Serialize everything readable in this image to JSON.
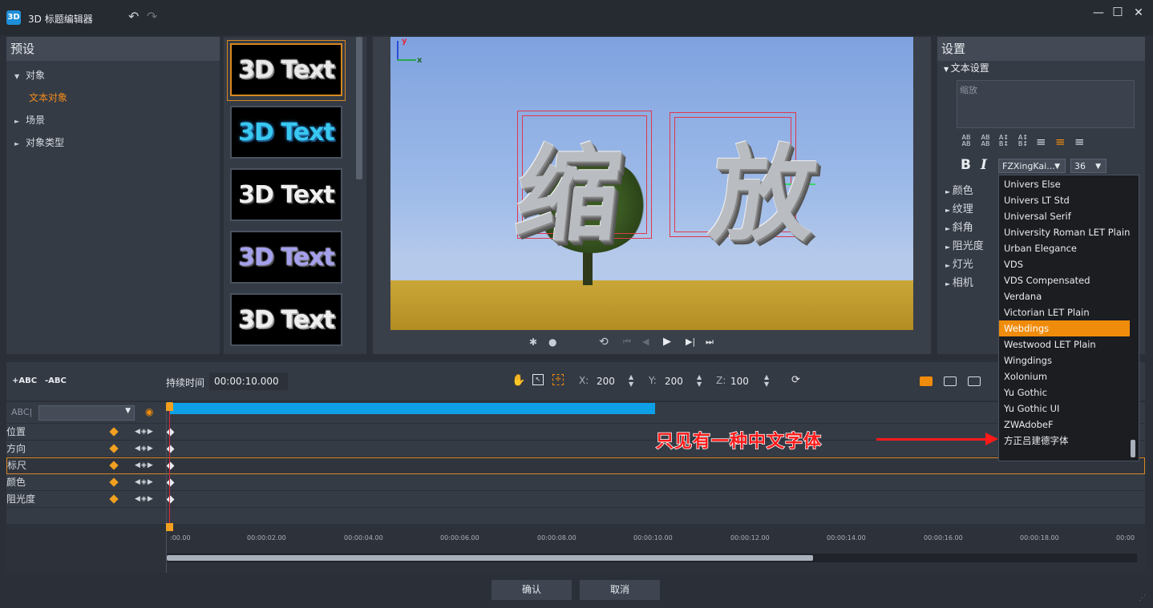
{
  "window": {
    "logo": "3D",
    "title": "3D 标题编辑器",
    "controls": {
      "minimize": "—",
      "maximize": "□",
      "close": "✕"
    }
  },
  "presets": {
    "header": "预设",
    "items": [
      {
        "arrow": "▼",
        "label": "对象"
      },
      {
        "arrow": "",
        "label": "文本对象"
      },
      {
        "arrow": "►",
        "label": "场景"
      },
      {
        "arrow": "►",
        "label": "对象类型"
      }
    ],
    "thumbs": [
      "3D Text",
      "3D Text",
      "3D Text",
      "3D Text",
      "3D Text"
    ]
  },
  "preview": {
    "axis_y": "y",
    "axis_x": "x",
    "text": "缩 放"
  },
  "settings": {
    "header": "设置",
    "section": "文本设置",
    "text_value": "缩放",
    "bold": "B",
    "italic": "I",
    "font_selected": "FZXingKai...",
    "size_selected": "36",
    "groups": [
      "颜色",
      "纹理",
      "斜角",
      "阻光度",
      "灯光",
      "相机"
    ],
    "font_options": [
      "Univers Else",
      "Univers LT Std",
      "Universal Serif",
      "University Roman LET Plain",
      "Urban Elegance",
      "VDS",
      "VDS Compensated",
      "Verdana",
      "Victorian LET Plain",
      "Webdings",
      "Westwood LET Plain",
      "Wingdings",
      "Xolonium",
      "Yu Gothic",
      "Yu Gothic UI",
      "ZWAdobeF",
      "方正吕建德字体"
    ],
    "highlighted_font": "Webdings"
  },
  "timeline": {
    "add_abc": "+ABC",
    "remove_abc": "-ABC",
    "duration_label": "持续时间",
    "duration_value": "00:00:10.000",
    "x_label": "X:",
    "x_value": "200",
    "y_label": "Y:",
    "y_value": "200",
    "z_label": "Z:",
    "z_value": "100",
    "track_selector": "ABC|",
    "tracks": [
      "位置",
      "方向",
      "标尺",
      "颜色",
      "阻光度"
    ],
    "ruler": [
      ":00.00",
      "00:00:02.00",
      "00:00:04.00",
      "00:00:06.00",
      "00:00:08.00",
      "00:00:10.00",
      "00:00:12.00",
      "00:00:14.00",
      "00:00:16.00",
      "00:00:18.00",
      "00:00"
    ],
    "clip_fraction": 0.5
  },
  "annotation": "只见有一种中文字体",
  "buttons": {
    "ok": "确认",
    "cancel": "取消"
  },
  "colors": {
    "accent": "#f08c0c",
    "clip": "#0ea0e6",
    "annotation": "#ff1a1a"
  }
}
